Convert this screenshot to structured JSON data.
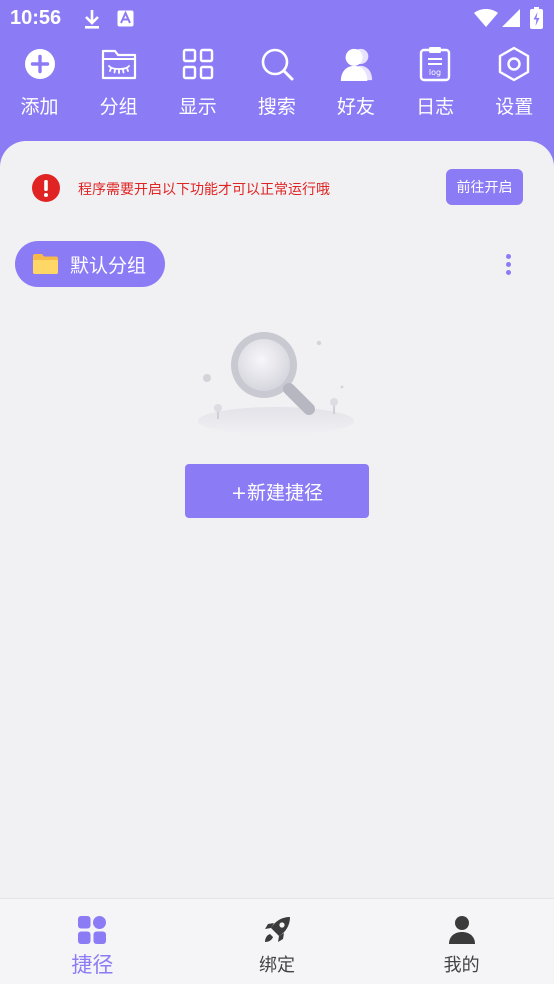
{
  "status_bar": {
    "time": "10:56",
    "icons": [
      "download-icon",
      "font-a-icon",
      "wifi-icon",
      "signal-icon",
      "battery-charging-icon"
    ]
  },
  "toolbar": {
    "items": [
      {
        "label": "添加",
        "icon": "plus-circle-icon"
      },
      {
        "label": "分组",
        "icon": "folder-group-icon"
      },
      {
        "label": "显示",
        "icon": "grid-icon"
      },
      {
        "label": "搜索",
        "icon": "search-icon"
      },
      {
        "label": "好友",
        "icon": "friends-icon"
      },
      {
        "label": "日志",
        "icon": "log-clipboard-icon"
      },
      {
        "label": "设置",
        "icon": "settings-hexagon-icon"
      }
    ]
  },
  "notice": {
    "text": "程序需要开启以下功能才可以正常运行哦",
    "button": "前往开启",
    "icon": "alert-icon"
  },
  "group": {
    "label": "默认分组",
    "icon": "folder-icon"
  },
  "empty_state": {
    "illustration": "empty-search-illustration",
    "button": "+新建捷径"
  },
  "bottom_nav": {
    "items": [
      {
        "label": "捷径",
        "icon": "shortcuts-icon",
        "active": true
      },
      {
        "label": "绑定",
        "icon": "rocket-icon",
        "active": false
      },
      {
        "label": "我的",
        "icon": "profile-icon",
        "active": false
      }
    ]
  },
  "colors": {
    "accent": "#8b7cf6",
    "alert": "#e02424",
    "background": "#f1f1f4"
  }
}
